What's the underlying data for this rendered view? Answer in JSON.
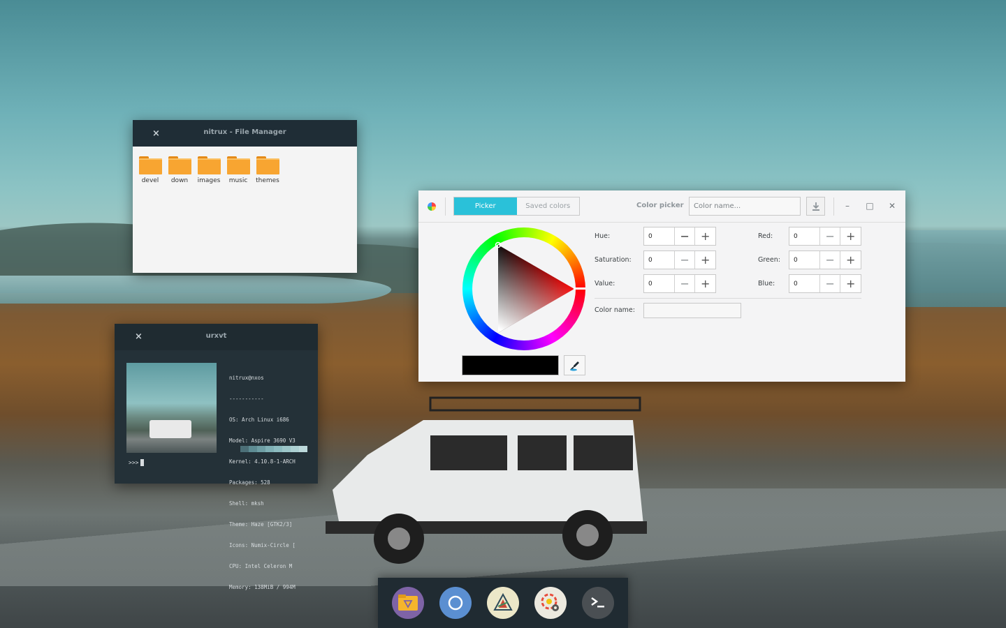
{
  "file_manager": {
    "title": "nitrux - File Manager",
    "close_label": "×",
    "files": [
      {
        "name": "devel"
      },
      {
        "name": "down"
      },
      {
        "name": "images"
      },
      {
        "name": "music"
      },
      {
        "name": "themes"
      }
    ]
  },
  "terminal": {
    "title": "urxvt",
    "close_label": "×",
    "info_lines": [
      "nitrux@nxos",
      "-----------",
      "OS: Arch Linux i686",
      "Model: Aspire 3690 V3",
      "Kernel: 4.10.8-1-ARCH",
      "Packages: 528",
      "Shell: mksh",
      "Theme: Haze [GTK2/3]",
      "Icons: Numix-Circle [",
      "CPU: Intel Celeron M",
      "Memory: 138MiB / 994M"
    ],
    "palette": [
      "#4c6f77",
      "#5e8c93",
      "#6e9ea4",
      "#7fb0b5",
      "#8cbcc0",
      "#9cc6c9",
      "#acd0d2",
      "#bcd9db"
    ],
    "prompt": ">>>"
  },
  "color_picker": {
    "tabs": [
      {
        "label": "Picker",
        "active": true
      },
      {
        "label": "Saved colors",
        "active": false
      }
    ],
    "header_title": "Color picker",
    "name_placeholder": "Color name...",
    "window_controls": {
      "minimize": "–",
      "maximize": "□",
      "close": "✕"
    },
    "hsv": [
      {
        "label": "Hue:",
        "value": "0"
      },
      {
        "label": "Saturation:",
        "value": "0"
      },
      {
        "label": "Value:",
        "value": "0"
      }
    ],
    "rgb": [
      {
        "label": "Red:",
        "value": "0"
      },
      {
        "label": "Green:",
        "value": "0"
      },
      {
        "label": "Blue:",
        "value": "0"
      }
    ],
    "color_name_label": "Color name:",
    "current_color": "#000000",
    "accent": "#2ac1d9"
  },
  "dock": {
    "apps": [
      {
        "icon": "file-manager-icon"
      },
      {
        "icon": "chromium-icon"
      },
      {
        "icon": "drawing-app-icon"
      },
      {
        "icon": "color-settings-icon"
      },
      {
        "icon": "terminal-icon"
      }
    ]
  }
}
